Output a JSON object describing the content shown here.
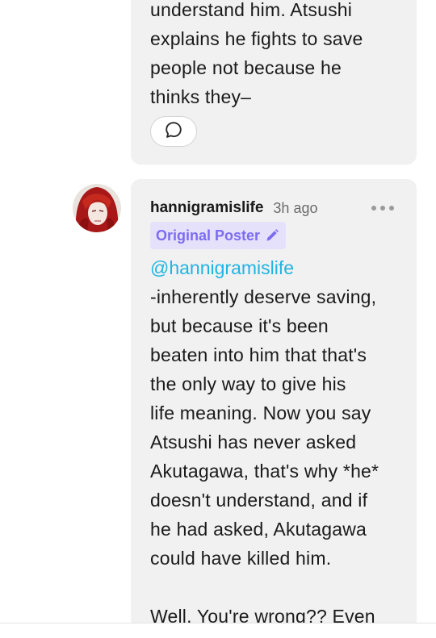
{
  "previous_comment": {
    "lines": [
      "understand him. Atsushi",
      "explains he fights to save",
      "people not because he",
      "thinks they–"
    ],
    "reply_icon": "speech-bubble-icon"
  },
  "comment": {
    "username": "hannigramislife",
    "timestamp": "3h ago",
    "badge_label": "Original Poster",
    "badge_icon": "pencil-icon",
    "more_icon": "more-options-icon",
    "mention": "@hannigramislife",
    "lines": [
      "-inherently deserve saving,",
      "but because it's been",
      "beaten into him that that's",
      "the only way to give his",
      "life meaning. Now you say",
      "Atsushi has never asked",
      "Akutagawa, that's why *he*",
      "doesn't understand, and if",
      "he had asked, Akutagawa",
      "could have killed him."
    ],
    "lines_after_gap": [
      "Well. You're wrong?? Even"
    ]
  },
  "colors": {
    "bubble_bg": "#f1f1f1",
    "mention": "#20b4e3",
    "badge_bg": "#e6e1fb",
    "badge_text": "#7b6cf0"
  }
}
